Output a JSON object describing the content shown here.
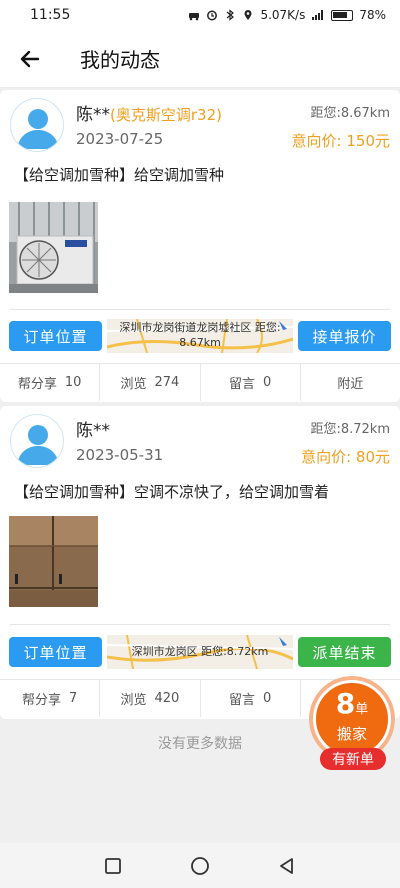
{
  "status_bar": {
    "time": "11:55",
    "network_speed": "5.07K/s",
    "battery": "78%"
  },
  "header": {
    "title": "我的动态"
  },
  "posts": [
    {
      "name": "陈**",
      "tag": "(奥克斯空调r32)",
      "date": "2023-07-25",
      "distance": "距您:8.67km",
      "price": "意向价:  150元",
      "text": "【给空调加雪种】给空调加雪种",
      "location_button": "订单位置",
      "map_address": "深圳市龙岗街道龙岗墟社区   距您:",
      "map_distance": "8.67km",
      "action_button": "接单报价",
      "stats": {
        "share_label": "帮分享",
        "share_count": "10",
        "views_label": "浏览",
        "views_count": "274",
        "comments_label": "留言",
        "comments_count": "0",
        "nearby_label": "附近"
      }
    },
    {
      "name": "陈**",
      "tag": "",
      "date": "2023-05-31",
      "distance": "距您:8.72km",
      "price": "意向价:  80元",
      "text": "【给空调加雪种】空调不凉快了，给空调加雪着",
      "location_button": "订单位置",
      "map_address": "深圳市龙岗区   距您:8.72km",
      "action_button": "派单结束",
      "stats": {
        "share_label": "帮分享",
        "share_count": "7",
        "views_label": "浏览",
        "views_count": "420",
        "comments_label": "留言",
        "comments_count": "0"
      }
    }
  ],
  "no_more_text": "没有更多数据",
  "float_badge": {
    "count": "8",
    "unit": "单",
    "label": "搬家",
    "new_label": "有新单"
  },
  "colors": {
    "accent_blue": "#2a9bf0",
    "accent_green": "#3bb44a",
    "accent_orange": "#f0a020",
    "badge_orange": "#f06a10",
    "badge_red": "#e62e2e"
  },
  "icons": {
    "back": "arrow-left-icon",
    "nav_recent": "square-icon",
    "nav_home": "circle-icon",
    "nav_back": "triangle-back-icon"
  }
}
